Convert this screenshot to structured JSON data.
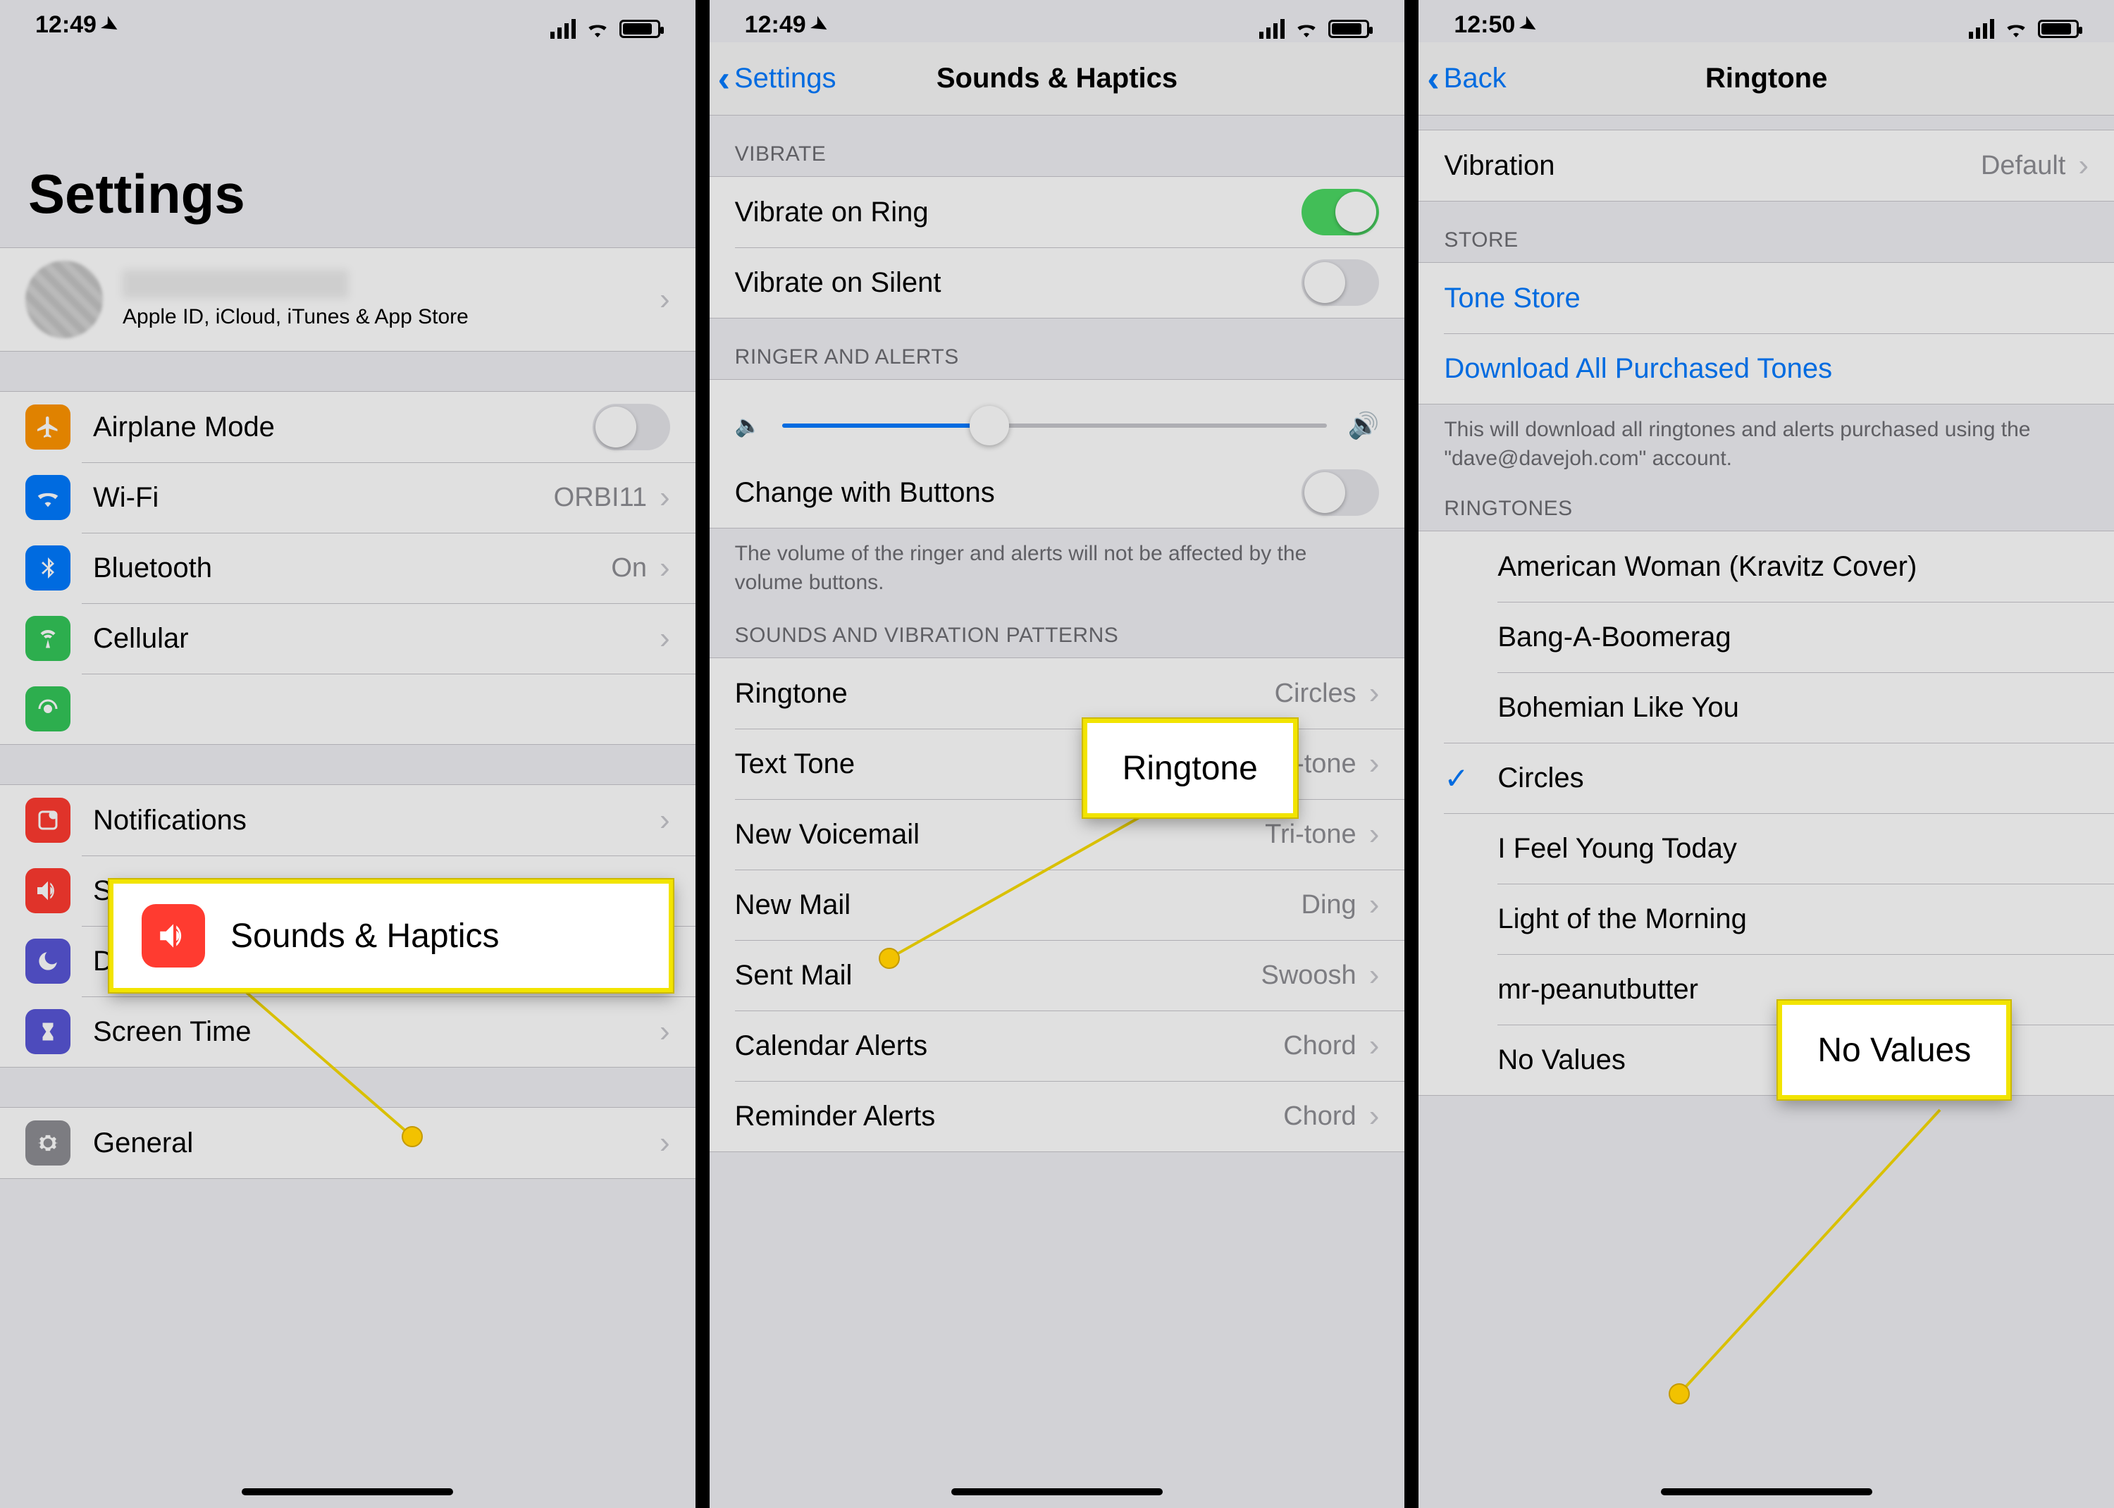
{
  "status": {
    "time1": "12:49",
    "time2": "12:49",
    "time3": "12:50"
  },
  "screen1": {
    "title": "Settings",
    "profile": {
      "subtitle": "Apple ID, iCloud, iTunes & App Store"
    },
    "rows": {
      "airplane": "Airplane Mode",
      "wifi": "Wi-Fi",
      "wifi_val": "ORBI11",
      "bluetooth": "Bluetooth",
      "bluetooth_val": "On",
      "cellular": "Cellular",
      "notifications": "Notifications",
      "sounds": "Sounds & Haptics",
      "dnd": "Do Not Disturb",
      "screentime": "Screen Time",
      "general": "General"
    },
    "callout": "Sounds & Haptics"
  },
  "screen2": {
    "back": "Settings",
    "title": "Sounds & Haptics",
    "hdr_vibrate": "VIBRATE",
    "vib_ring": "Vibrate on Ring",
    "vib_silent": "Vibrate on Silent",
    "hdr_ringer": "RINGER AND ALERTS",
    "change_buttons": "Change with Buttons",
    "ringer_footer": "The volume of the ringer and alerts will not be affected by the volume buttons.",
    "hdr_patterns": "SOUNDS AND VIBRATION PATTERNS",
    "ringtone": "Ringtone",
    "ringtone_val": "Circles",
    "texttone": "Text Tone",
    "texttone_val": "Tri-tone",
    "voicemail": "New Voicemail",
    "voicemail_val": "Tri-tone",
    "newmail": "New Mail",
    "newmail_val": "Ding",
    "sentmail": "Sent Mail",
    "sentmail_val": "Swoosh",
    "calendar": "Calendar Alerts",
    "calendar_val": "Chord",
    "reminder": "Reminder Alerts",
    "reminder_val": "Chord",
    "callout": "Ringtone"
  },
  "screen3": {
    "back": "Back",
    "title": "Ringtone",
    "vibration": "Vibration",
    "vibration_val": "Default",
    "hdr_store": "STORE",
    "tone_store": "Tone Store",
    "download_all": "Download All Purchased Tones",
    "store_footer": "This will download all ringtones and alerts purchased using the \"dave@davejoh.com\" account.",
    "hdr_ringtones": "RINGTONES",
    "tones": {
      "t0": "American Woman (Kravitz Cover)",
      "t1": "Bang-A-Boomerag",
      "t2": "Bohemian Like You",
      "t3": "Circles",
      "t4": "I Feel Young Today",
      "t5": "Light of the Morning",
      "t6": "mr-peanutbutter",
      "t7": "No Values"
    },
    "selected": "Circles",
    "callout": "No Values"
  }
}
